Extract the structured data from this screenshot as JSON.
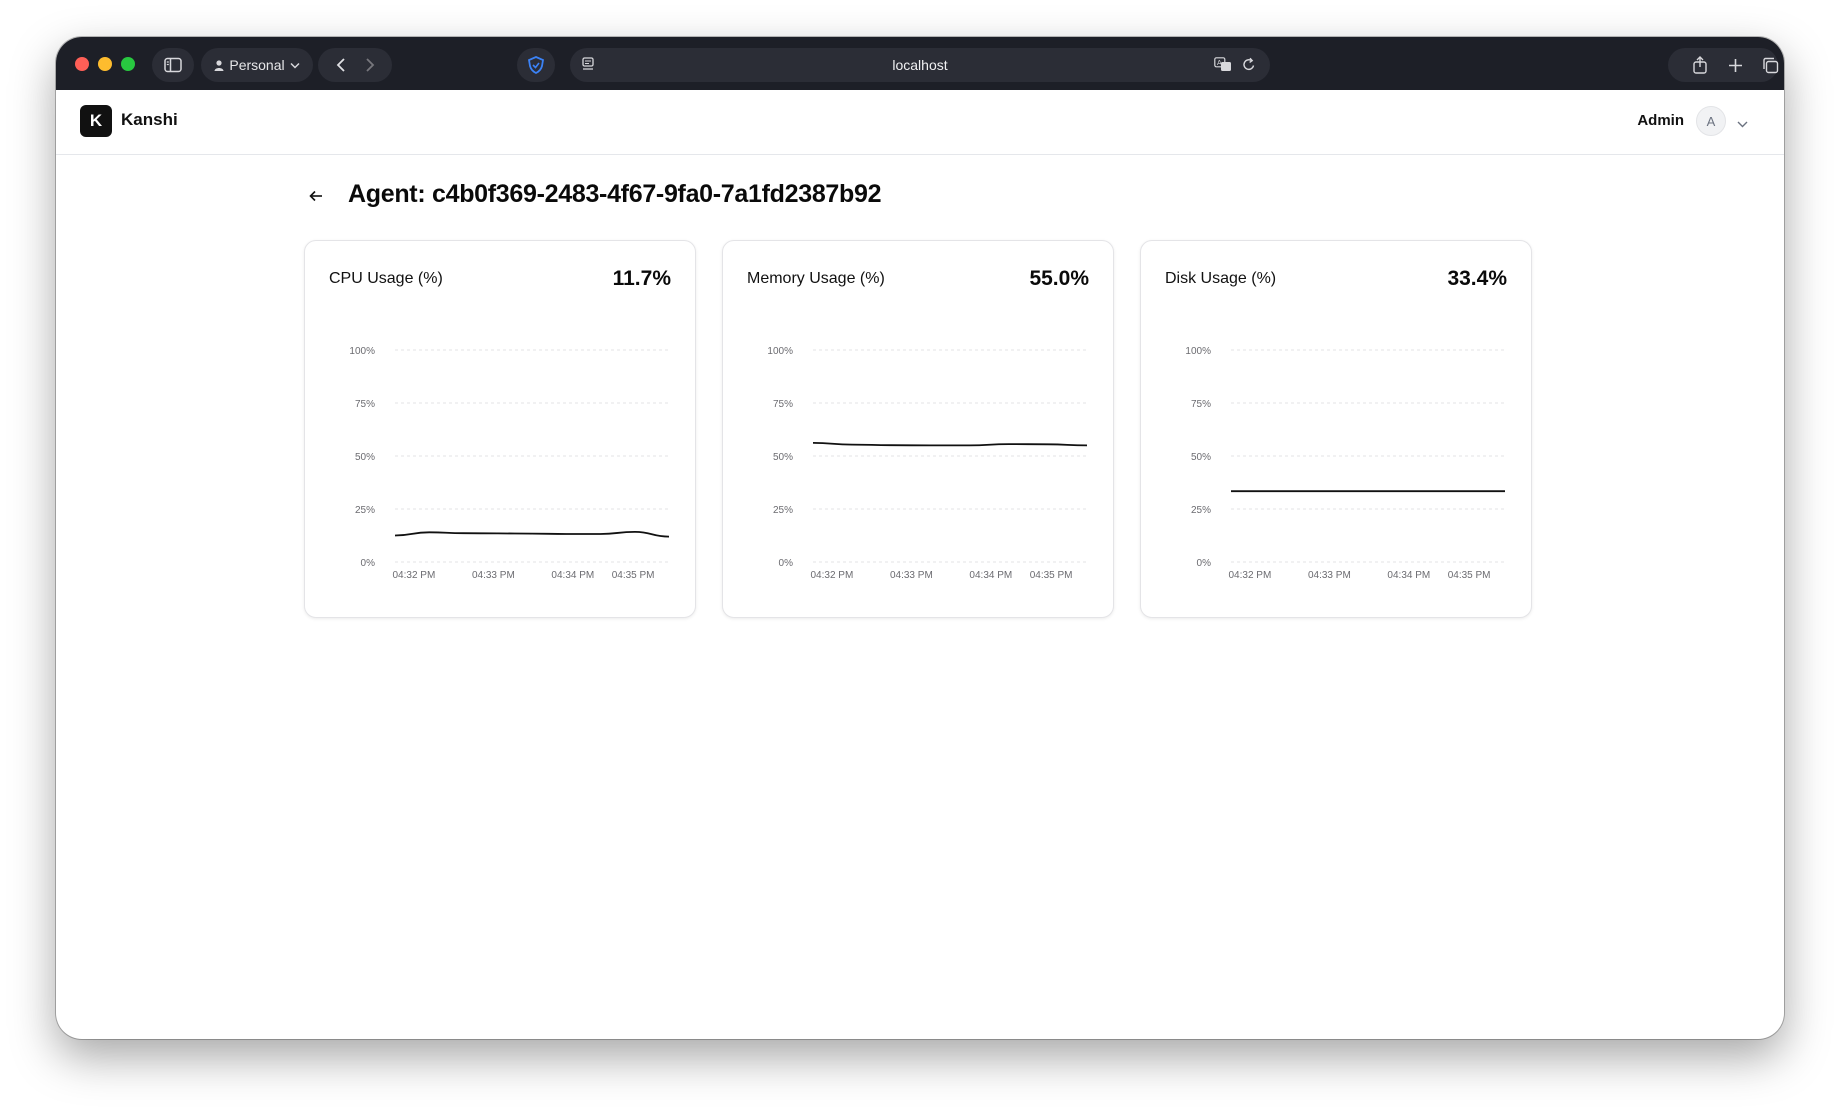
{
  "browser": {
    "profile_label": "Personal",
    "address": "localhost"
  },
  "app": {
    "brand_letter": "K",
    "brand_name": "Kanshi",
    "user_name": "Admin",
    "avatar_letter": "A"
  },
  "page": {
    "title": "Agent: c4b0f369-2483-4f67-9fa0-7a1fd2387b92"
  },
  "cards": [
    {
      "title": "CPU Usage (%)",
      "value": "11.7%"
    },
    {
      "title": "Memory Usage (%)",
      "value": "55.0%"
    },
    {
      "title": "Disk Usage (%)",
      "value": "33.4%"
    }
  ],
  "chart_data": [
    {
      "type": "line",
      "title": "CPU Usage (%)",
      "ylim": [
        0,
        100
      ],
      "y_ticks": [
        "0%",
        "25%",
        "50%",
        "75%",
        "100%"
      ],
      "x_ticks": [
        "04:32 PM",
        "04:33 PM",
        "04:34 PM",
        "04:35 PM"
      ],
      "grid": true,
      "series": [
        {
          "values": [
            12.5,
            14.0,
            13.6,
            13.5,
            13.4,
            13.2,
            13.2,
            14.2,
            12.0
          ]
        }
      ]
    },
    {
      "type": "line",
      "title": "Memory Usage (%)",
      "ylim": [
        0,
        100
      ],
      "y_ticks": [
        "0%",
        "25%",
        "50%",
        "75%",
        "100%"
      ],
      "x_ticks": [
        "04:32 PM",
        "04:33 PM",
        "04:34 PM",
        "04:35 PM"
      ],
      "grid": true,
      "series": [
        {
          "values": [
            56.2,
            55.4,
            55.1,
            55.0,
            55.0,
            55.6,
            55.5,
            55.0
          ]
        }
      ]
    },
    {
      "type": "line",
      "title": "Disk Usage (%)",
      "ylim": [
        0,
        100
      ],
      "y_ticks": [
        "0%",
        "25%",
        "50%",
        "75%",
        "100%"
      ],
      "x_ticks": [
        "04:32 PM",
        "04:33 PM",
        "04:34 PM",
        "04:35 PM"
      ],
      "grid": true,
      "series": [
        {
          "values": [
            33.4,
            33.4,
            33.4,
            33.4,
            33.4,
            33.4,
            33.4,
            33.4
          ]
        }
      ]
    }
  ]
}
